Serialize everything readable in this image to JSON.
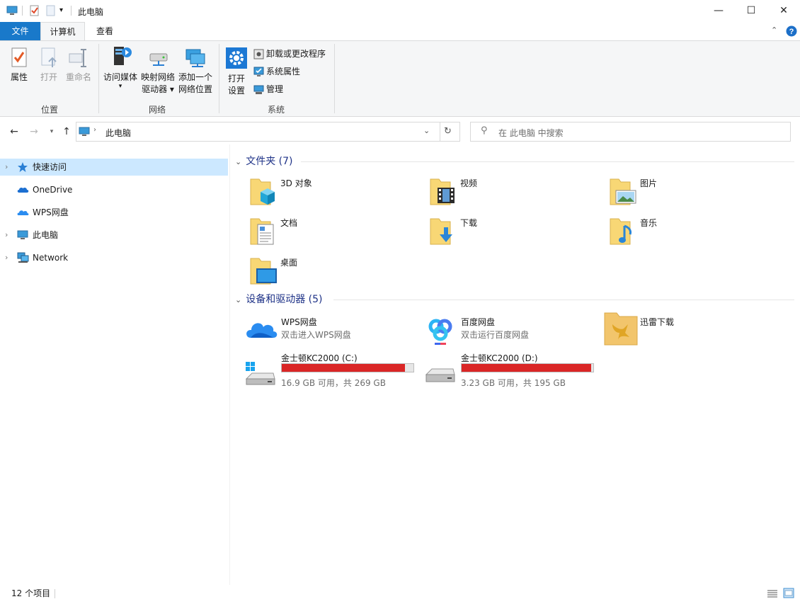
{
  "window": {
    "title": "此电脑",
    "minimize": "—",
    "maximize": "☐",
    "close": "✕"
  },
  "ribbon_tabs": {
    "file": "文件",
    "computer": "计算机",
    "view": "查看"
  },
  "ribbon": {
    "location": {
      "label": "位置",
      "properties": "属性",
      "open": "打开",
      "rename": "重命名"
    },
    "network": {
      "label": "网络",
      "media": "访问媒体",
      "map_drive_1": "映射网络",
      "map_drive_2": "驱动器 ▾",
      "add_location_1": "添加一个",
      "add_location_2": "网络位置"
    },
    "system": {
      "label": "系统",
      "settings_1": "打开",
      "settings_2": "设置",
      "uninstall": "卸载或更改程序",
      "system_properties": "系统属性",
      "manage": "管理"
    }
  },
  "address": {
    "path": "此电脑",
    "search_placeholder": "在 此电脑 中搜索"
  },
  "nav": {
    "quick_access": "快速访问",
    "onedrive": "OneDrive",
    "wps": "WPS网盘",
    "this_pc": "此电脑",
    "network": "Network"
  },
  "folders_section": {
    "header": "文件夹 (7)",
    "items": [
      {
        "name": "3D 对象",
        "icon": "3d-objects-folder-icon"
      },
      {
        "name": "视频",
        "icon": "videos-folder-icon"
      },
      {
        "name": "图片",
        "icon": "pictures-folder-icon"
      },
      {
        "name": "文档",
        "icon": "documents-folder-icon"
      },
      {
        "name": "下载",
        "icon": "downloads-folder-icon"
      },
      {
        "name": "音乐",
        "icon": "music-folder-icon"
      },
      {
        "name": "桌面",
        "icon": "desktop-folder-icon"
      }
    ]
  },
  "devices_section": {
    "header": "设备和驱动器 (5)",
    "apps": [
      {
        "name": "WPS网盘",
        "sub": "双击进入WPS网盘",
        "icon": "wps-cloud-icon"
      },
      {
        "name": "百度网盘",
        "sub": "双击运行百度网盘",
        "icon": "baidu-netdisk-icon"
      },
      {
        "name": "迅雷下载",
        "sub": "",
        "icon": "thunder-download-icon"
      }
    ],
    "drives": [
      {
        "name": "金士顿KC2000 (C:)",
        "free": "16.9 GB 可用，共 269 GB",
        "used_fraction": 0.937,
        "icon": "windows-drive-icon"
      },
      {
        "name": "金士顿KC2000 (D:)",
        "free": "3.23 GB 可用，共 195 GB",
        "used_fraction": 0.983,
        "icon": "hard-drive-icon"
      }
    ],
    "bar_color": "#da2626"
  },
  "status": {
    "count": "12 个项目"
  },
  "colors": {
    "accent": "#1979ca",
    "selection": "#cce8ff",
    "section_header": "#1e3287",
    "folder": "#f8d775"
  }
}
